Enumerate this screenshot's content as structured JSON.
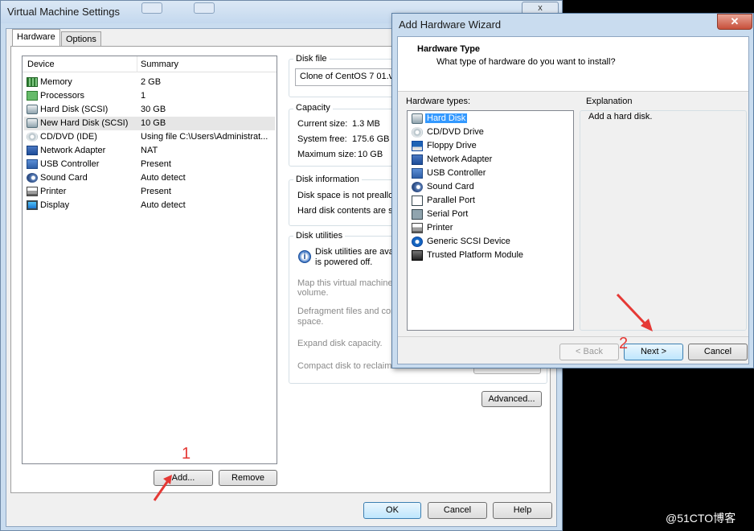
{
  "main_window": {
    "title": "Virtual Machine Settings",
    "close_glyph": "x",
    "tabs": [
      "Hardware",
      "Options"
    ],
    "device_list": {
      "headers": [
        "Device",
        "Summary"
      ],
      "rows": [
        {
          "name": "Memory",
          "summary": "2 GB",
          "icon": "memory-icon"
        },
        {
          "name": "Processors",
          "summary": "1",
          "icon": "processor-icon"
        },
        {
          "name": "Hard Disk (SCSI)",
          "summary": "30 GB",
          "icon": "hard-disk-icon"
        },
        {
          "name": "New Hard Disk (SCSI)",
          "summary": "10 GB",
          "icon": "hard-disk-icon"
        },
        {
          "name": "CD/DVD (IDE)",
          "summary": "Using file C:\\Users\\Administrat...",
          "icon": "cd-dvd-icon"
        },
        {
          "name": "Network Adapter",
          "summary": "NAT",
          "icon": "network-adapter-icon"
        },
        {
          "name": "USB Controller",
          "summary": "Present",
          "icon": "usb-icon"
        },
        {
          "name": "Sound Card",
          "summary": "Auto detect",
          "icon": "sound-card-icon"
        },
        {
          "name": "Printer",
          "summary": "Present",
          "icon": "printer-icon"
        },
        {
          "name": "Display",
          "summary": "Auto detect",
          "icon": "display-icon"
        }
      ]
    },
    "add_button": "Add...",
    "remove_button": "Remove",
    "disk_file": {
      "label": "Disk file",
      "value": "Clone of CentOS 7 01.v"
    },
    "capacity": {
      "label": "Capacity",
      "current_label": "Current size:",
      "current_value": "1.3 MB",
      "free_label": "System free:",
      "free_value": "175.6 GB",
      "max_label": "Maximum size:",
      "max_value": "10 GB"
    },
    "disk_information": {
      "label": "Disk information",
      "line1": "Disk space is not preallocat",
      "line2": "Hard disk contents are st"
    },
    "disk_utilities": {
      "label": "Disk utilities",
      "info_line1": "Disk utilities are avai",
      "info_line2": "is powered off.",
      "map_line1": "Map this virtual machine",
      "map_line2": "volume.",
      "defrag_line1": "Defragment files and con",
      "defrag_line2": "space.",
      "expand": "Expand disk capacity.",
      "compact": "Compact disk to reclaim u"
    },
    "advanced_button": "Advanced...",
    "ok_button": "OK",
    "cancel_button": "Cancel",
    "help_button": "Help"
  },
  "wizard": {
    "title": "Add Hardware Wizard",
    "close_glyph": "✕",
    "heading": "Hardware Type",
    "subheading": "What type of hardware do you want to install?",
    "list_label": "Hardware types:",
    "items": [
      {
        "label": "Hard Disk",
        "icon": "hard-disk-icon",
        "selected": true
      },
      {
        "label": "CD/DVD Drive",
        "icon": "cd-dvd-icon"
      },
      {
        "label": "Floppy Drive",
        "icon": "floppy-icon"
      },
      {
        "label": "Network Adapter",
        "icon": "network-adapter-icon"
      },
      {
        "label": "USB Controller",
        "icon": "usb-icon"
      },
      {
        "label": "Sound Card",
        "icon": "sound-card-icon"
      },
      {
        "label": "Parallel Port",
        "icon": "parallel-port-icon"
      },
      {
        "label": "Serial Port",
        "icon": "serial-port-icon"
      },
      {
        "label": "Printer",
        "icon": "printer-icon"
      },
      {
        "label": "Generic SCSI Device",
        "icon": "scsi-icon"
      },
      {
        "label": "Trusted Platform Module",
        "icon": "tpm-icon"
      }
    ],
    "explanation_label": "Explanation",
    "explanation_text": "Add a hard disk.",
    "back_button": "< Back",
    "next_button": "Next >",
    "cancel_button": "Cancel"
  },
  "annotations": {
    "marker1": "1",
    "marker2": "2",
    "color": "#e53935"
  },
  "watermark": "@51CTO博客"
}
